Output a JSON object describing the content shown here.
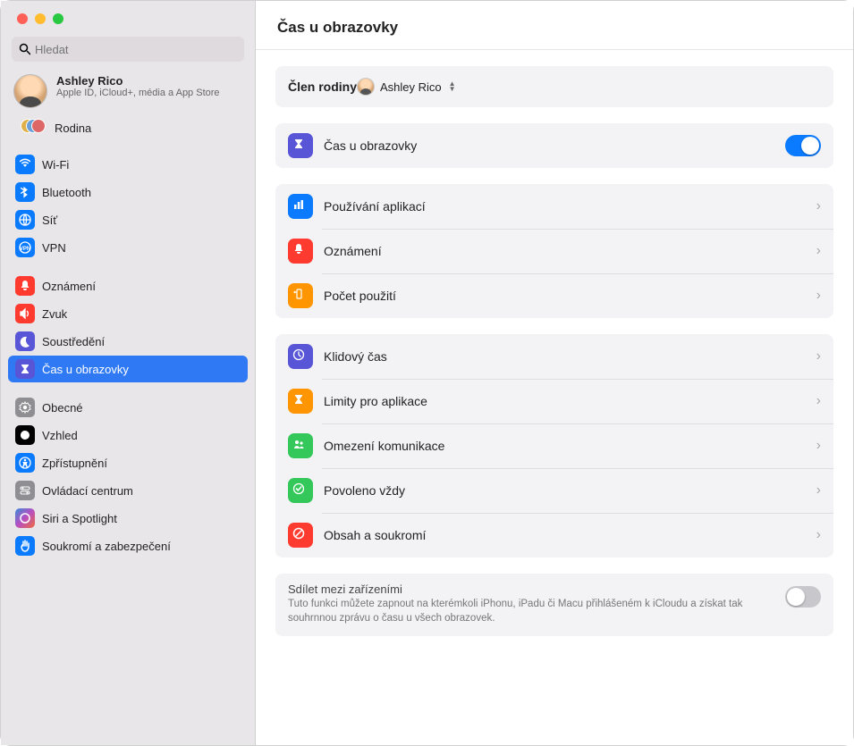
{
  "search": {
    "placeholder": "Hledat"
  },
  "account": {
    "name": "Ashley Rico",
    "subtitle": "Apple ID, iCloud+, média a App Store"
  },
  "family": {
    "label": "Rodina"
  },
  "sidebar": {
    "group1": [
      {
        "label": "Wi-Fi",
        "icon": "wifi",
        "clr": "ic-blue"
      },
      {
        "label": "Bluetooth",
        "icon": "bluetooth",
        "clr": "ic-blue"
      },
      {
        "label": "Síť",
        "icon": "globe",
        "clr": "ic-blue"
      },
      {
        "label": "VPN",
        "icon": "vpn",
        "clr": "ic-blue"
      }
    ],
    "group2": [
      {
        "label": "Oznámení",
        "icon": "bell",
        "clr": "ic-red"
      },
      {
        "label": "Zvuk",
        "icon": "sound",
        "clr": "ic-red"
      },
      {
        "label": "Soustředění",
        "icon": "moon",
        "clr": "ic-purple"
      },
      {
        "label": "Čas u obrazovky",
        "icon": "hourglass",
        "clr": "ic-purple",
        "active": true
      }
    ],
    "group3": [
      {
        "label": "Obecné",
        "icon": "gear",
        "clr": "ic-gray"
      },
      {
        "label": "Vzhled",
        "icon": "appearance",
        "clr": "ic-black"
      },
      {
        "label": "Zpřístupnění",
        "icon": "access",
        "clr": "ic-blue"
      },
      {
        "label": "Ovládací centrum",
        "icon": "switches",
        "clr": "ic-gray"
      },
      {
        "label": "Siri a Spotlight",
        "icon": "siri",
        "clr": "ic-siri"
      },
      {
        "label": "Soukromí a zabezpečení",
        "icon": "hand",
        "clr": "ic-hand"
      }
    ]
  },
  "header": {
    "title": "Čas u obrazovky"
  },
  "memberRow": {
    "label": "Člen rodiny",
    "selected": "Ashley Rico"
  },
  "mainToggle": {
    "label": "Čas u obrazovky",
    "on": true
  },
  "usageRows": [
    {
      "label": "Používání aplikací",
      "icon": "bars",
      "clr": "ic-blue"
    },
    {
      "label": "Oznámení",
      "icon": "bell",
      "clr": "ic-red"
    },
    {
      "label": "Počet použití",
      "icon": "pickups",
      "clr": "ic-orange"
    }
  ],
  "limitRows": [
    {
      "label": "Klidový čas",
      "icon": "clock",
      "clr": "ic-purple"
    },
    {
      "label": "Limity pro aplikace",
      "icon": "hourglass",
      "clr": "ic-orange"
    },
    {
      "label": "Omezení komunikace",
      "icon": "people",
      "clr": "ic-green"
    },
    {
      "label": "Povoleno vždy",
      "icon": "check",
      "clr": "ic-green"
    },
    {
      "label": "Obsah a soukromí",
      "icon": "nosign",
      "clr": "ic-red"
    }
  ],
  "share": {
    "title": "Sdílet mezi zařízeními",
    "subtitle": "Tuto funkci můžete zapnout na kterémkoli iPhonu, iPadu či Macu přihlášeném k iCloudu a získat tak souhrnnou zprávu o času u všech obrazovek.",
    "on": false
  }
}
